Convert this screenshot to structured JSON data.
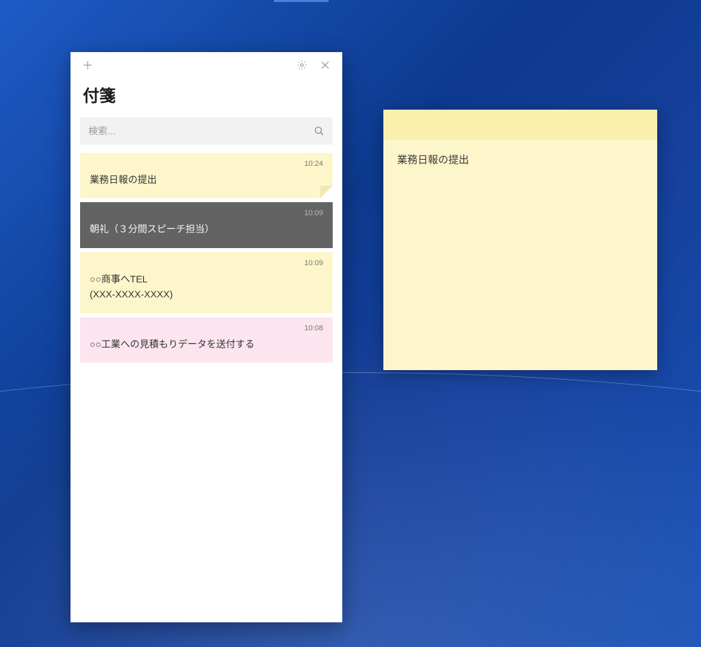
{
  "app": {
    "title": "付箋"
  },
  "search": {
    "placeholder": "検索..."
  },
  "notes": [
    {
      "time": "10:24",
      "text": "業務日報の提出",
      "color": "yellow",
      "hasCorner": true
    },
    {
      "time": "10:09",
      "text": "朝礼（３分間スピーチ担当）",
      "color": "dark",
      "hasCorner": false
    },
    {
      "time": "10:09",
      "text": "○○商事へTEL\n(XXX-XXXX-XXXX)",
      "color": "yellow",
      "hasCorner": false
    },
    {
      "time": "10:08",
      "text": "○○工業への見積もりデータを送付する",
      "color": "pink",
      "hasCorner": false
    }
  ],
  "stickyNote": {
    "content": "業務日報の提出"
  }
}
